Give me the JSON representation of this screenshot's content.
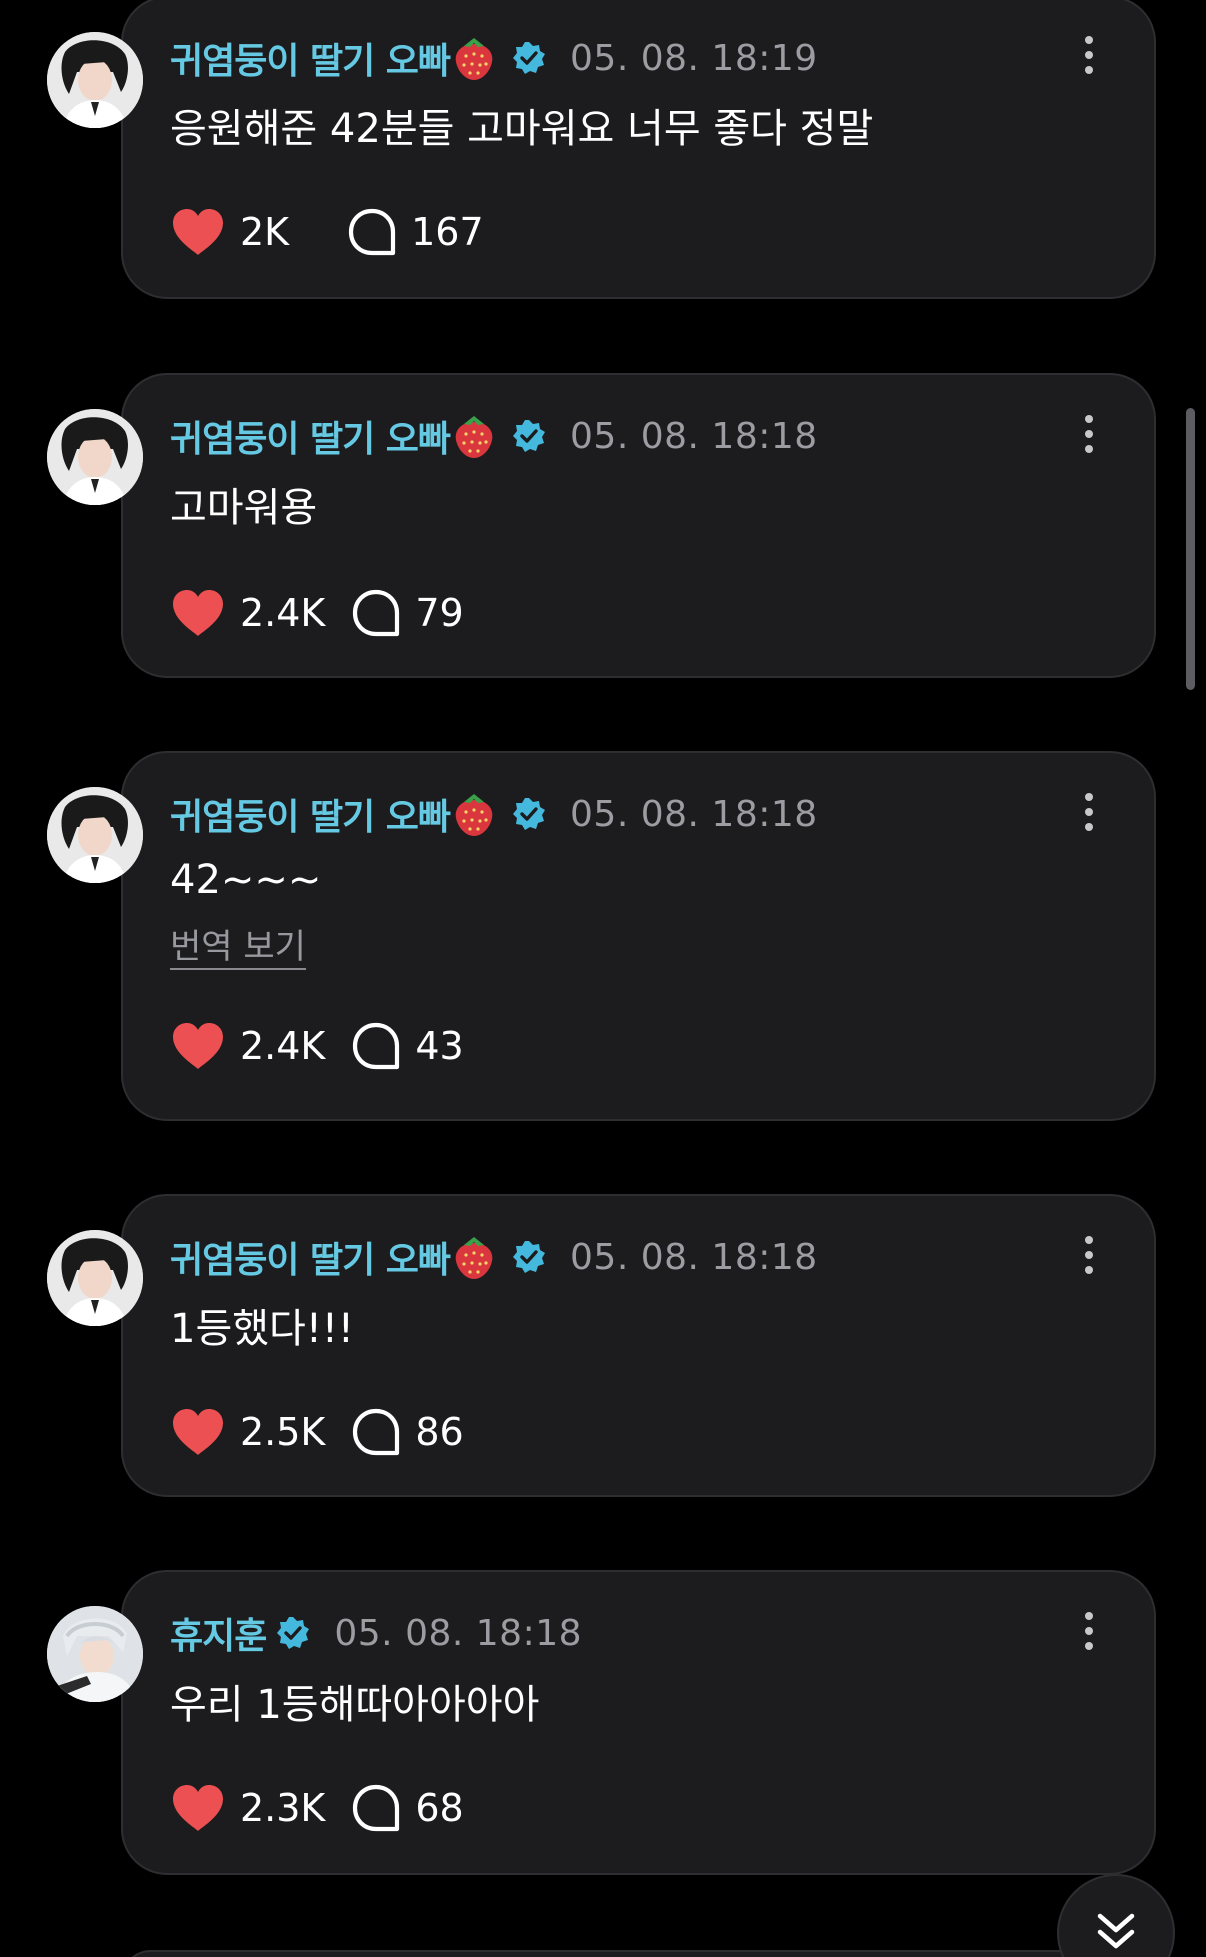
{
  "colors": {
    "background": "#000000",
    "card": "#1c1c1e",
    "username": "#66c9e3",
    "verified": "#44b9dd",
    "like": "#ec5052",
    "time": "#9c9ca2"
  },
  "icons": {
    "like": "heart-icon",
    "comment": "comment-bubble-icon",
    "more": "more-vertical-icon",
    "verified": "verified-badge-icon",
    "scroll": "double-chevron-down-icon"
  },
  "posts": [
    {
      "author": "귀염둥이 딸기 오빠",
      "has_strawberry": true,
      "timestamp": "05. 08. 18:19",
      "text": "응원해준 42분들 고마워요 너무 좋다 정말",
      "likes": "2K",
      "comments": "167"
    },
    {
      "author": "귀염둥이 딸기 오빠",
      "has_strawberry": true,
      "timestamp": "05. 08. 18:18",
      "text": "고마워용",
      "likes": "2.4K",
      "comments": "79"
    },
    {
      "author": "귀염둥이 딸기 오빠",
      "has_strawberry": true,
      "timestamp": "05. 08. 18:18",
      "text": "42~~~",
      "translate_label": "번역 보기",
      "likes": "2.4K",
      "comments": "43"
    },
    {
      "author": "귀염둥이 딸기 오빠",
      "has_strawberry": true,
      "timestamp": "05. 08. 18:18",
      "text": "1등했다!!!",
      "likes": "2.5K",
      "comments": "86"
    },
    {
      "author": "휴지훈",
      "has_strawberry": false,
      "timestamp": "05. 08. 18:18",
      "text": "우리 1등해따아아아아",
      "likes": "2.3K",
      "comments": "68"
    }
  ]
}
